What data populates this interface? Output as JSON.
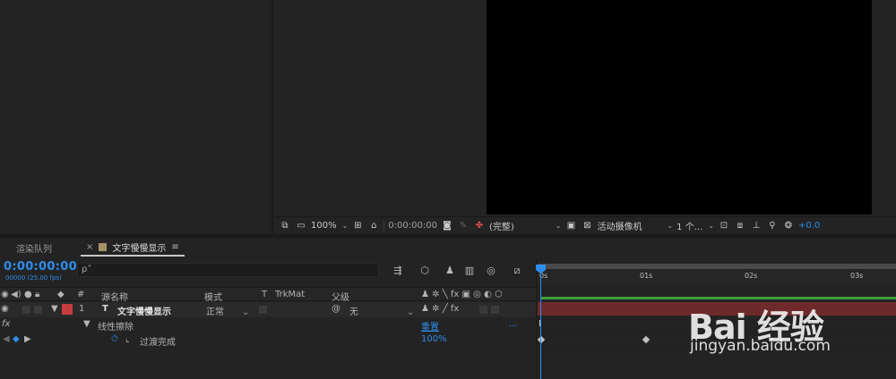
{
  "viewer": {
    "zoom": "100%",
    "timecode": "0:00:00:00",
    "resolution": "(完整)",
    "camera": "活动摄像机",
    "views": "1 个...",
    "exposure": "+0.0"
  },
  "tabs": {
    "render_queue": "渲染队列",
    "comp_name": "文字慢慢显示",
    "close": "×",
    "menu": "≡"
  },
  "timeline": {
    "timecode": "0:00:00:00",
    "fps": "00000 (25.00 fps)",
    "search_placeholder": "ρ˅"
  },
  "columns": {
    "num": "#",
    "source_name": "源名称",
    "mode": "模式",
    "t": "T",
    "trkmat": "TrkMat",
    "parent": "父级",
    "switches_fx": "fx"
  },
  "layer": {
    "number": "1",
    "type_icon": "T",
    "name": "文字慢慢显示",
    "mode": "正常",
    "parent": "无",
    "label_color": "#c83c3c"
  },
  "effect": {
    "fx_label": "fx",
    "name": "线性擦除",
    "reset": "重置",
    "more": "..."
  },
  "property": {
    "name": "过渡完成",
    "value": "100",
    "unit": "%"
  },
  "ruler": {
    "ticks": [
      "0s",
      "01s",
      "02s",
      "03s"
    ]
  },
  "watermark": {
    "logo": "Bai 经验",
    "url": "jingyan.baidu.com"
  }
}
